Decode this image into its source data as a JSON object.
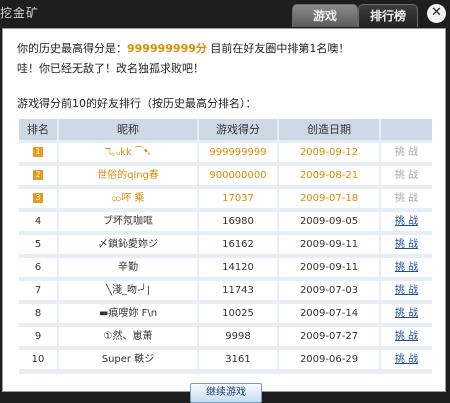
{
  "window": {
    "title": "挖金矿",
    "tabs": [
      {
        "label": "游戏"
      },
      {
        "label": "排行榜"
      }
    ],
    "close_symbol": "✕"
  },
  "summary": {
    "best_prefix": "你的历史最高得分是：",
    "best_score": "999999999分",
    "best_suffix": " 目前在好友圈中排第1名噢！",
    "line2": "哇！你已经无敌了！改名独孤求败吧！",
    "ranking_heading": "游戏得分前10的好友排行（按历史最高分排名）："
  },
  "table": {
    "headers": [
      "排名",
      "昵称",
      "游戏得分",
      "创造日期",
      ""
    ],
    "rows": [
      {
        "rank": "1",
        "name": "ℸ｡ᵤkk ⁀➷",
        "score": "999999999",
        "date": "2009-09-12",
        "action": "挑 战",
        "enabled": false
      },
      {
        "rank": "2",
        "name": "世俗的qlng春",
        "score": "900000000",
        "date": "2009-08-21",
        "action": "挑 战",
        "enabled": false
      },
      {
        "rank": "3",
        "name": "ထ吥 乘",
        "score": "17037",
        "date": "2009-07-18",
        "action": "挑 战",
        "enabled": false
      },
      {
        "rank": "4",
        "name": "ブ坏氖咖哐",
        "score": "16980",
        "date": "2009-09-05",
        "action": "挑 战",
        "enabled": true
      },
      {
        "rank": "5",
        "name": "〆鎖鈊愛妳ジ",
        "score": "16162",
        "date": "2009-09-11",
        "action": "挑 战",
        "enabled": true
      },
      {
        "rank": "6",
        "name": "辛勤",
        "score": "14120",
        "date": "2009-09-11",
        "action": "挑 战",
        "enabled": true
      },
      {
        "rank": "7",
        "name": "╲淺_吻-╯|",
        "score": "11743",
        "date": "2009-07-03",
        "action": "挑 战",
        "enabled": true
      },
      {
        "rank": "8",
        "name": "▬痕嗖妳 F\\n",
        "score": "10025",
        "date": "2009-07-14",
        "action": "挑 战",
        "enabled": true
      },
      {
        "rank": "9",
        "name": "①然、崽萧",
        "score": "9998",
        "date": "2009-07-27",
        "action": "挑 战",
        "enabled": true
      },
      {
        "rank": "10",
        "name": "Super  軼ジ",
        "score": "3161",
        "date": "2009-06-29",
        "action": "挑 战",
        "enabled": true
      }
    ]
  },
  "continue_button": "继续游戏",
  "colors": {
    "accent_orange": "#e08a00",
    "link_blue": "#1a4fa0",
    "header_blue": "#cdd9e7"
  }
}
